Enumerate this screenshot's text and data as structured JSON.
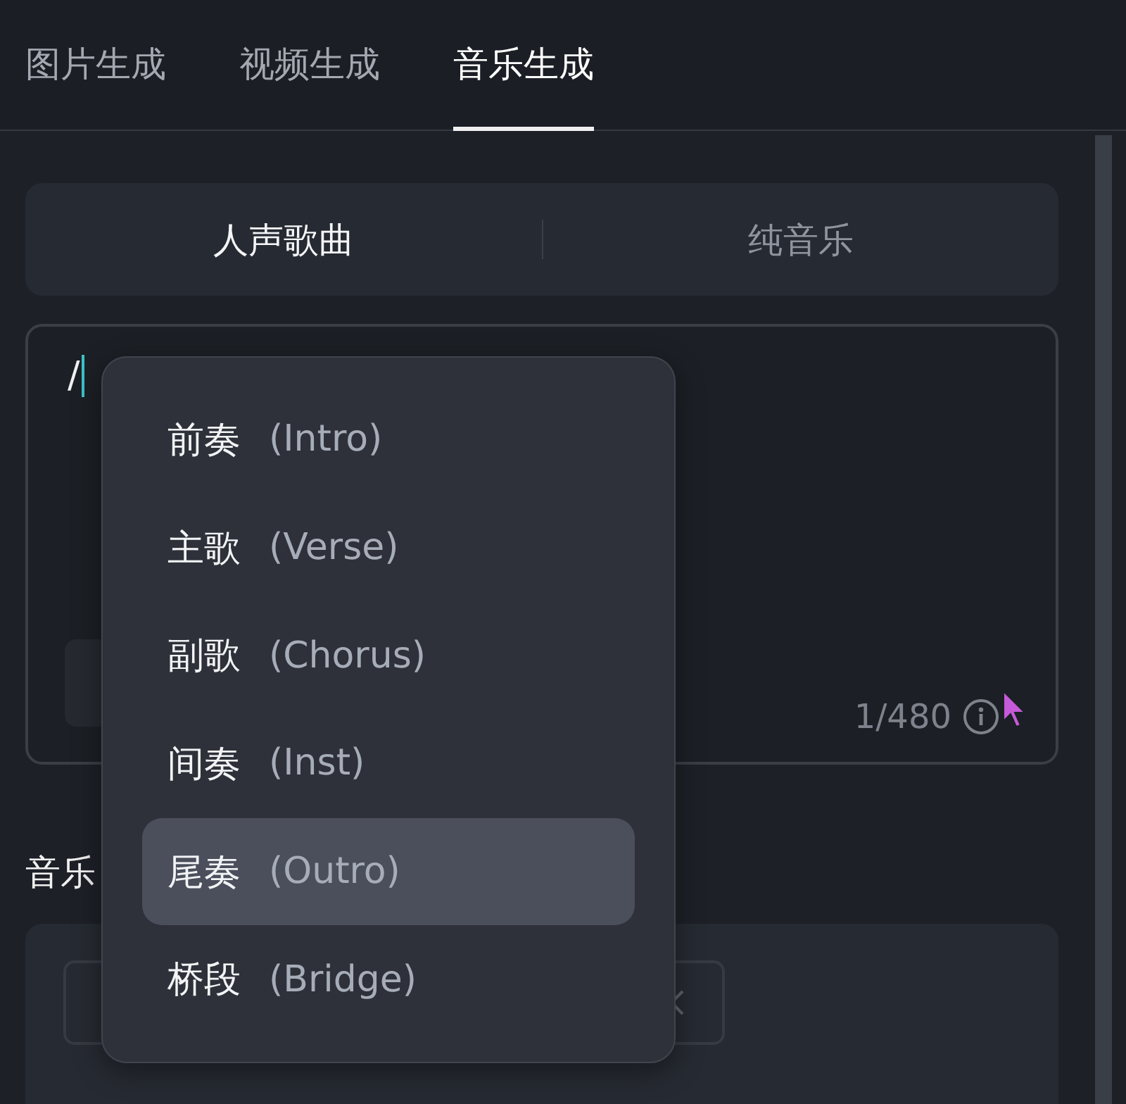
{
  "tabs": [
    {
      "label": "图片生成",
      "selected": false
    },
    {
      "label": "视频生成",
      "selected": false
    },
    {
      "label": "音乐生成",
      "selected": true
    }
  ],
  "mode_toggle": [
    {
      "label": "人声歌曲",
      "selected": true
    },
    {
      "label": "纯音乐",
      "selected": false
    }
  ],
  "lyrics_input": {
    "value": "/",
    "counter": "1/480"
  },
  "section_menu": {
    "items": [
      {
        "name": "前奏",
        "tag": "(Intro)",
        "selected": false
      },
      {
        "name": "主歌",
        "tag": "(Verse)",
        "selected": false
      },
      {
        "name": "副歌",
        "tag": "(Chorus)",
        "selected": false
      },
      {
        "name": "间奏",
        "tag": "(Inst)",
        "selected": false
      },
      {
        "name": "尾奏",
        "tag": "(Outro)",
        "selected": true
      },
      {
        "name": "桥段",
        "tag": "(Bridge)",
        "selected": false
      }
    ]
  },
  "music_section": {
    "label": "音乐"
  }
}
